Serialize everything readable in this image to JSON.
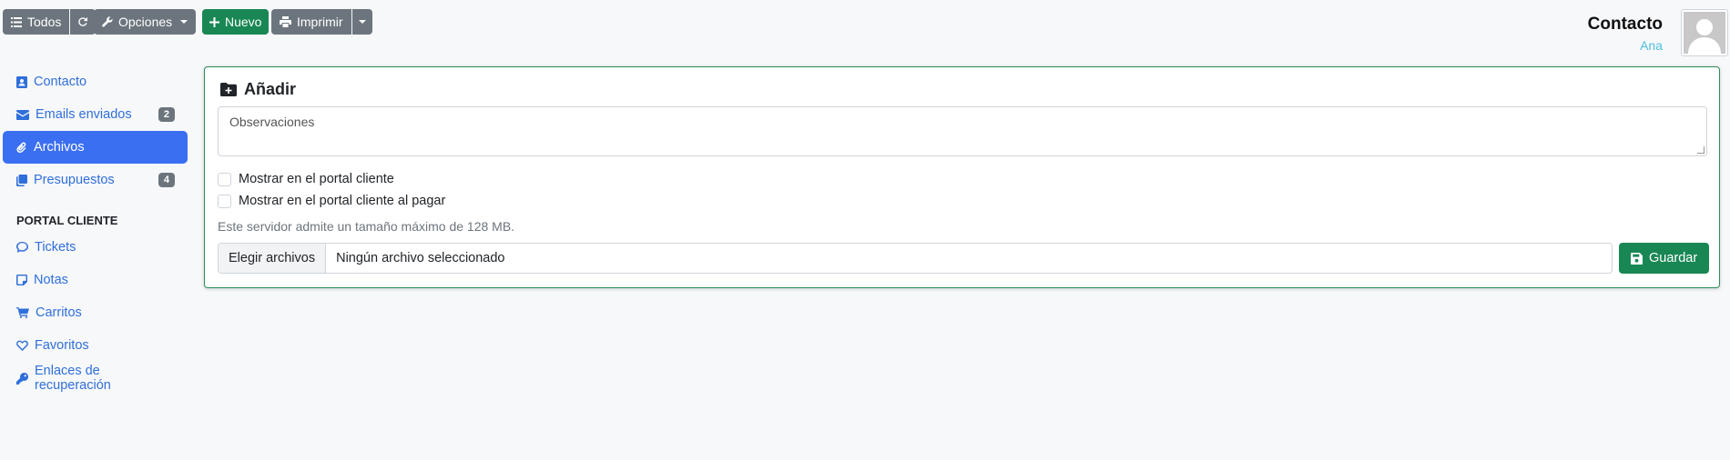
{
  "toolbar": {
    "all_label": "Todos",
    "options_label": "Opciones",
    "new_label": "Nuevo",
    "print_label": "Imprimir"
  },
  "header": {
    "title": "Contacto",
    "subtitle": "Ana"
  },
  "sidebar": {
    "items": [
      {
        "label": "Contacto",
        "icon": "address-card-icon"
      },
      {
        "label": "Emails enviados",
        "icon": "envelope-icon",
        "badge": "2"
      },
      {
        "label": "Archivos",
        "icon": "paperclip-icon",
        "active": true
      },
      {
        "label": "Presupuestos",
        "icon": "copy-icon",
        "badge": "4"
      }
    ],
    "section_heading": "PORTAL CLIENTE",
    "portal_items": [
      {
        "label": "Tickets",
        "icon": "comment-icon"
      },
      {
        "label": "Notas",
        "icon": "note-icon"
      },
      {
        "label": "Carritos",
        "icon": "cart-icon"
      },
      {
        "label": "Favoritos",
        "icon": "heart-icon"
      },
      {
        "label": "Enlaces de recuperación",
        "icon": "key-icon"
      }
    ]
  },
  "form": {
    "title": "Añadir",
    "notes_placeholder": "Observaciones",
    "show_in_portal_label": "Mostrar en el portal cliente",
    "show_in_portal_on_pay_label": "Mostrar en el portal cliente al pagar",
    "max_size_text": "Este servidor admite un tamaño máximo de 128 MB.",
    "choose_files_label": "Elegir archivos",
    "no_file_label": "Ningún archivo seleccionado",
    "save_label": "Guardar"
  },
  "colors": {
    "primary": "#3b6ff2",
    "success": "#198754",
    "secondary": "#6c757d",
    "link": "#2f6fdb"
  }
}
